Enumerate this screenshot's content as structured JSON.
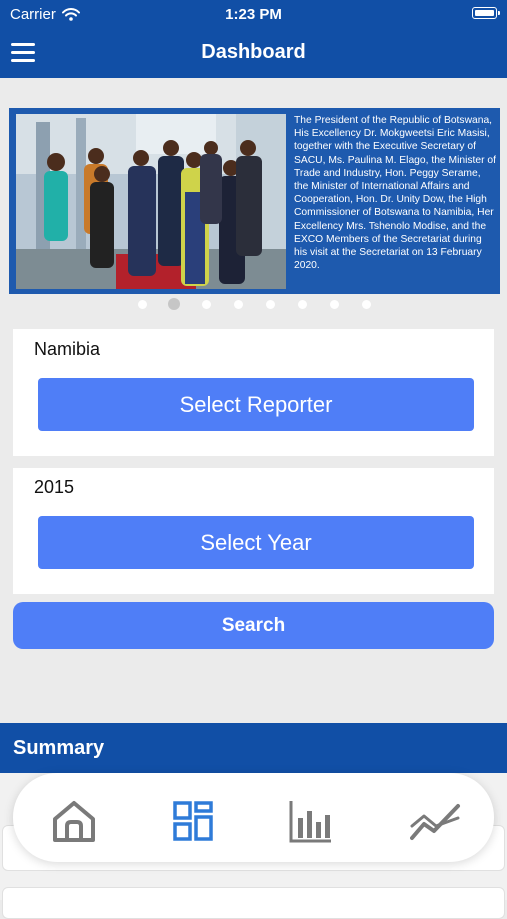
{
  "status_bar": {
    "carrier": "Carrier",
    "time": "1:23 PM"
  },
  "nav": {
    "title": "Dashboard",
    "menu_icon": "hamburger-menu-icon"
  },
  "carousel": {
    "caption": "The President of the Republic of Botswana, His Excellency Dr. Mokgweetsi Eric Masisi, together with the Executive Secretary of SACU, Ms. Paulina M. Elago, the Minister of Trade and Industry, Hon. Peggy Serame, the Minister of International Affairs and Cooperation, Hon. Dr. Unity Dow, the High Commissioner of Botswana to Namibia, Her Excellency Mrs. Tshenolo Modise, and the EXCO Members of the Secretariat during his visit at the Secretariat on 13 February 2020.",
    "page_count": 8,
    "active_page": 2
  },
  "reporter": {
    "value": "Namibia",
    "button_label": "Select Reporter"
  },
  "year": {
    "value": "2015",
    "button_label": "Select Year"
  },
  "search_label": "Search",
  "summary": {
    "title": "Summary"
  },
  "tabs": [
    {
      "icon": "home-icon",
      "active": false
    },
    {
      "icon": "dashboard-icon",
      "active": true
    },
    {
      "icon": "bar-chart-icon",
      "active": false
    },
    {
      "icon": "trend-line-icon",
      "active": false
    }
  ],
  "colors": {
    "primary": "#114fa6",
    "button": "#4f7ef7",
    "active_tab": "#2f7bd8",
    "inactive_tab": "#7a7a7a"
  }
}
